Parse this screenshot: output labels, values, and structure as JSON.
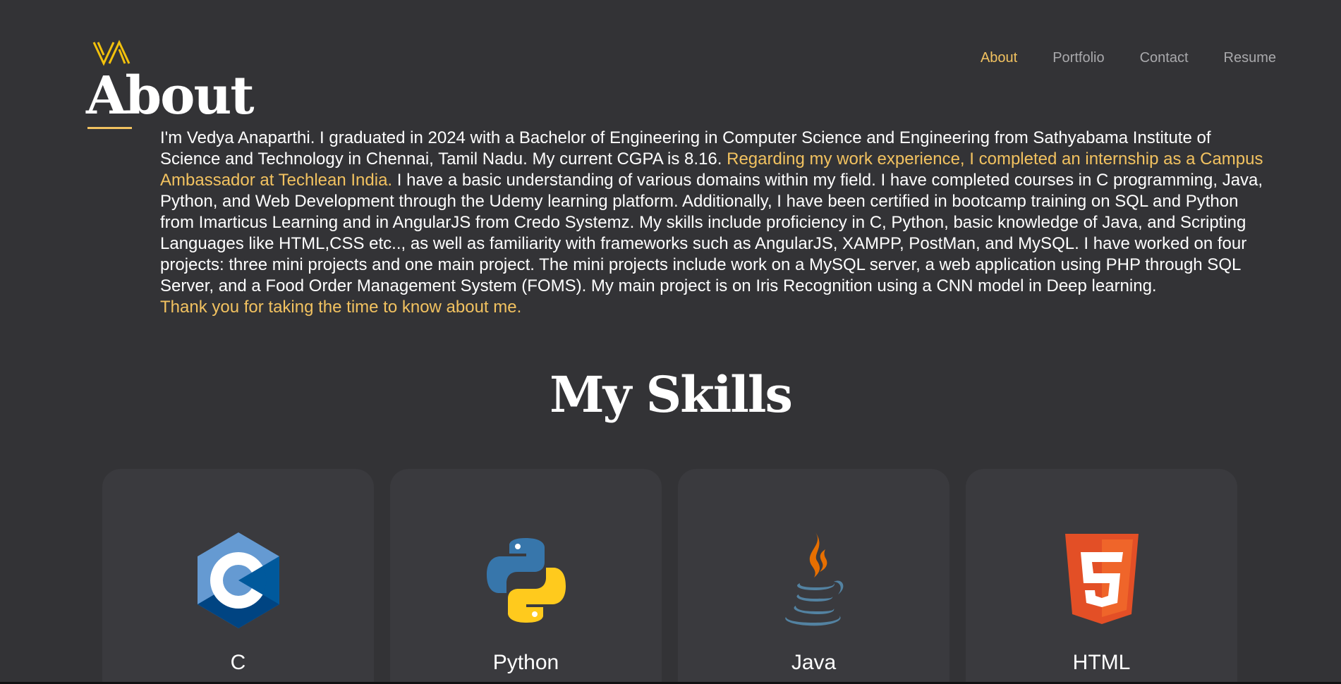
{
  "nav": {
    "items": [
      {
        "label": "About",
        "active": true
      },
      {
        "label": "Portfolio",
        "active": false
      },
      {
        "label": "Contact",
        "active": false
      },
      {
        "label": "Resume",
        "active": false
      }
    ]
  },
  "about": {
    "title": "About",
    "text_part1": "I'm Vedya Anaparthi. I graduated in 2024 with a Bachelor of Engineering in Computer Science and Engineering from Sathyabama Institute of Science and Technology in Chennai, Tamil Nadu. My current CGPA is 8.16. ",
    "text_highlight": "Regarding my work experience, I completed an internship as a Campus Ambassador at Techlean India.",
    "text_part2": " I have a basic understanding of various domains within my field. I have completed courses in C programming, Java, Python, and Web Development through the Udemy learning platform. Additionally, I have been certified in bootcamp training on SQL and Python from Imarticus Learning and in AngularJS from Credo Systemz. My skills include proficiency in C, Python, basic knowledge of Java, and Scripting Languages like HTML,CSS etc.., as well as familiarity with frameworks such as AngularJS, XAMPP, PostMan, and MySQL. I have worked on four projects: three mini projects and one main project. The mini projects include work on a MySQL server, a web application using PHP through SQL Server, and a Food Order Management System (FOMS). My main project is on Iris Recognition using a CNN model in Deep learning.",
    "thanks": "Thank you for taking the time to know about me."
  },
  "skills": {
    "title": "My Skills",
    "items": [
      {
        "label": "C",
        "icon": "c-language-icon"
      },
      {
        "label": "Python",
        "icon": "python-icon"
      },
      {
        "label": "Java",
        "icon": "java-icon"
      },
      {
        "label": "HTML",
        "icon": "html5-icon"
      }
    ]
  },
  "colors": {
    "background": "#333336",
    "card": "#3a3a3e",
    "accent": "#f2c260",
    "nav_inactive": "#a9a9ac",
    "text": "#ffffff"
  }
}
